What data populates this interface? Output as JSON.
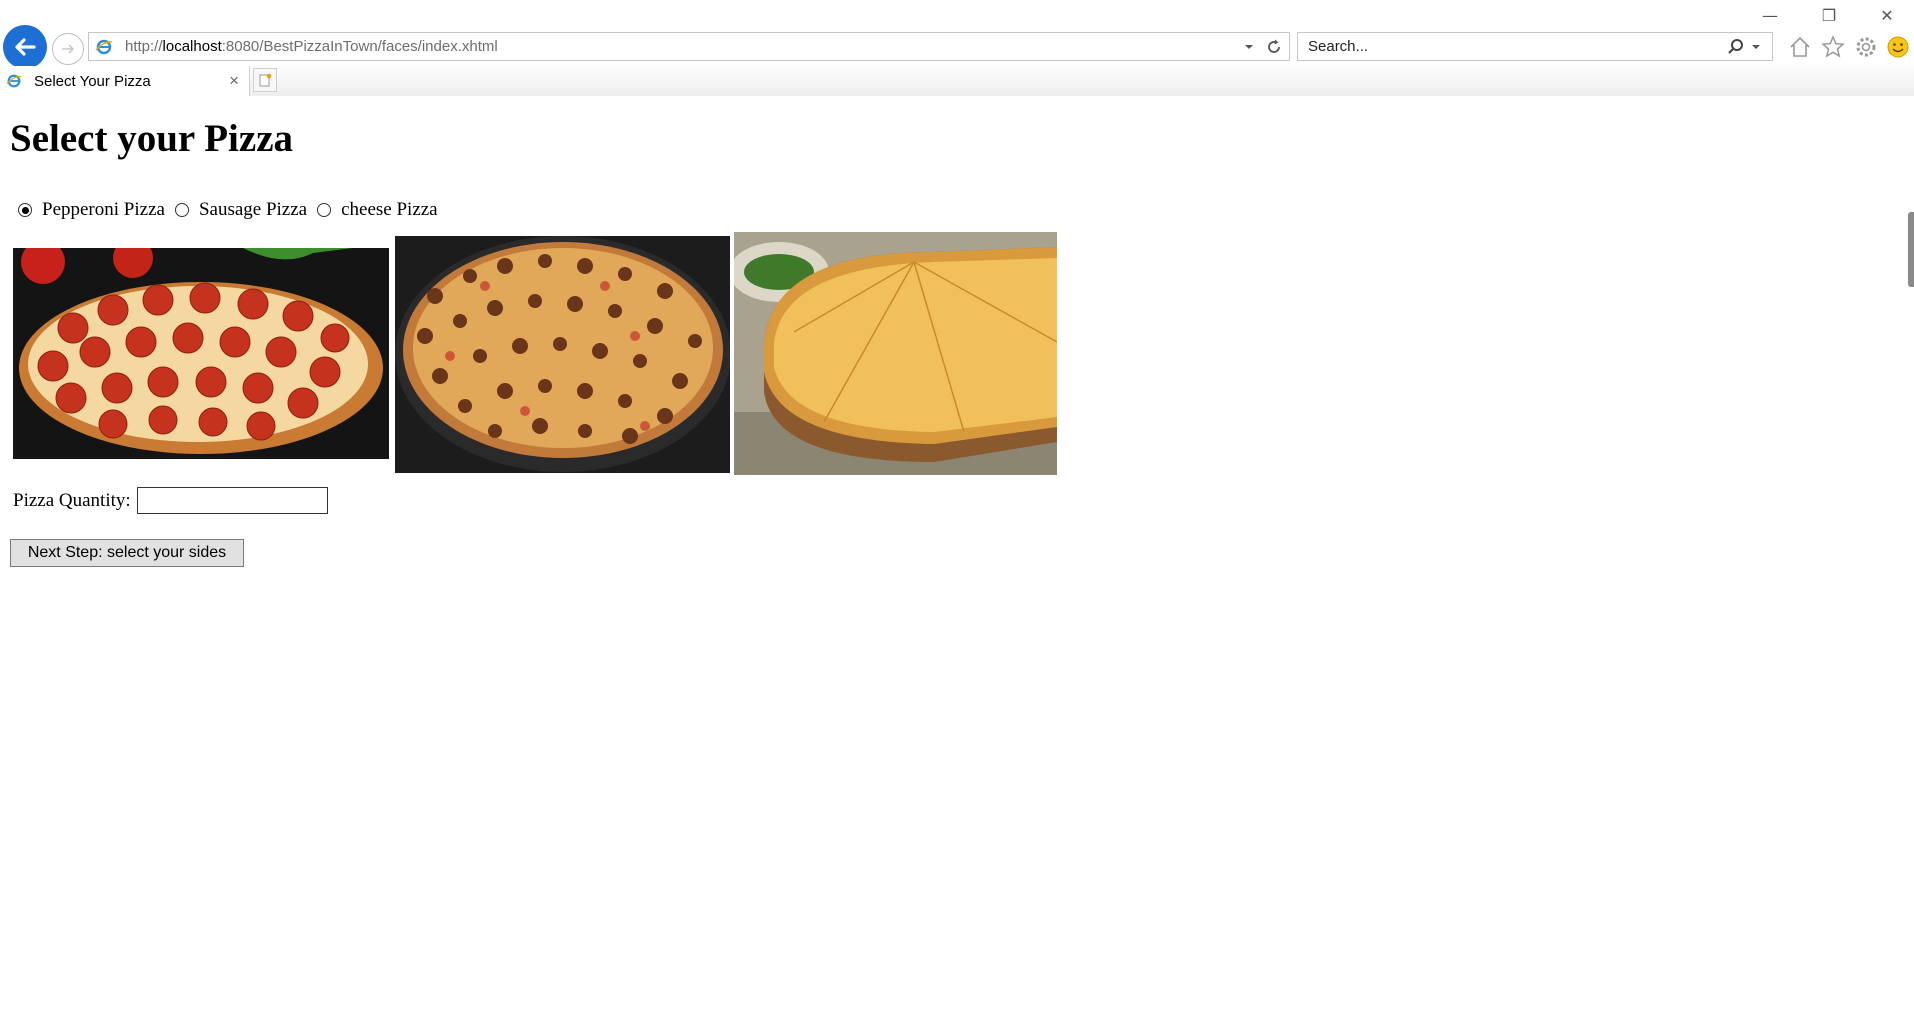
{
  "browser": {
    "url_prefix": "http://",
    "url_host": "localhost",
    "url_rest": ":8080/BestPizzaInTown/faces/index.xhtml",
    "search_placeholder": "Search...",
    "tab_title": "Select Your Pizza",
    "tab_close": "×",
    "window_minimize": "—",
    "window_restore": "❐",
    "window_close": "✕",
    "icons": [
      "back-icon",
      "forward-icon",
      "ie-icon",
      "dropdown-icon",
      "refresh-icon",
      "search-icon",
      "home-icon",
      "favorites-icon",
      "settings-icon",
      "smiley-icon",
      "new-tab-icon"
    ]
  },
  "page": {
    "heading": "Select your Pizza",
    "radio_options": [
      {
        "label": "Pepperoni Pizza",
        "selected": true
      },
      {
        "label": "Sausage Pizza",
        "selected": false
      },
      {
        "label": "cheese Pizza",
        "selected": false
      }
    ],
    "images": [
      "pepperoni-pizza",
      "sausage-pizza",
      "cheese-pizza"
    ],
    "quantity_label": "Pizza Quantity:",
    "quantity_value": "",
    "next_button": "Next Step: select your sides"
  },
  "colors": {
    "back_button": "#1e6fd4",
    "pizza_crust": "#d28a3c",
    "pepperoni": "#b8321e",
    "cheese": "#f2b84c"
  }
}
